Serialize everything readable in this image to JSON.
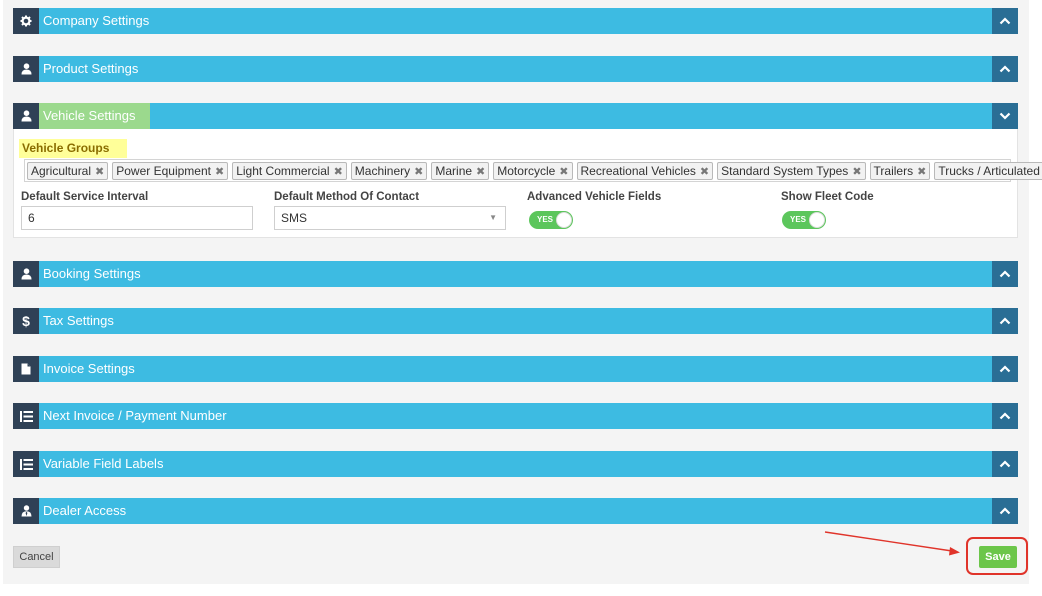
{
  "sections": {
    "company": {
      "title": "Company Settings",
      "icon": "gear-icon"
    },
    "product": {
      "title": "Product Settings",
      "icon": "user-icon"
    },
    "vehicle": {
      "title": "Vehicle Settings",
      "icon": "user-icon"
    },
    "booking": {
      "title": "Booking Settings",
      "icon": "user-icon"
    },
    "tax": {
      "title": "Tax Settings",
      "icon": "dollar-icon"
    },
    "invoice": {
      "title": "Invoice Settings",
      "icon": "document-icon"
    },
    "next_invoice": {
      "title": "Next Invoice / Payment Number",
      "icon": "list-icon"
    },
    "variable_labels": {
      "title": "Variable Field Labels",
      "icon": "list-icon"
    },
    "dealer": {
      "title": "Dealer Access",
      "icon": "user-tie-icon"
    }
  },
  "vehicle_settings": {
    "groups_label": "Vehicle Groups",
    "groups": [
      "Agricultural",
      "Power Equipment",
      "Light Commercial",
      "Machinery",
      "Marine",
      "Motorcycle",
      "Recreational Vehicles",
      "Standard System Types",
      "Trailers",
      "Trucks / Articulated"
    ],
    "remove_glyph": "✖",
    "service_interval_label": "Default Service Interval",
    "service_interval_value": "6",
    "contact_label": "Default Method Of Contact",
    "contact_value": "SMS",
    "advanced_fields_label": "Advanced Vehicle Fields",
    "advanced_fields_toggle": "YES",
    "fleet_code_label": "Show Fleet Code",
    "fleet_code_toggle": "YES"
  },
  "actions": {
    "cancel_label": "Cancel",
    "save_label": "Save"
  },
  "colors": {
    "bar": "#3dbbe2",
    "icon_bg": "#2f4156",
    "chevron_bg": "#2a6e95",
    "toggle_on": "#5cc65c",
    "save": "#6cc64a",
    "annotation": "#e0342a"
  }
}
